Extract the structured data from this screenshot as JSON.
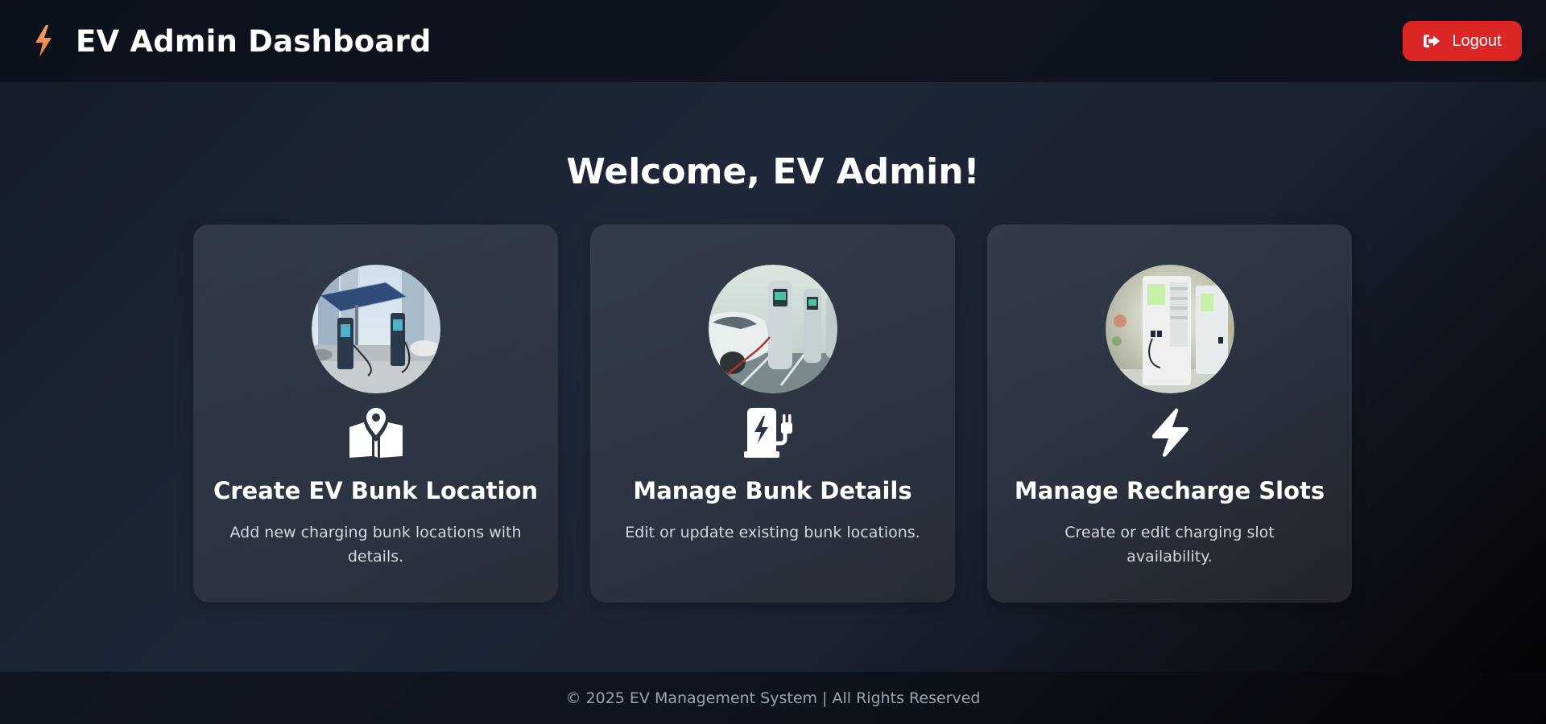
{
  "header": {
    "title": "EV Admin Dashboard",
    "brand_icon": "bolt-icon",
    "logout_label": "Logout",
    "logout_icon": "sign-out-icon"
  },
  "main": {
    "welcome": "Welcome, EV Admin!",
    "cards": [
      {
        "title": "Create EV Bunk Location",
        "description": "Add new charging bunk locations with details.",
        "icon": "map-location-icon",
        "image": "solar-charging-station-photo"
      },
      {
        "title": "Manage Bunk Details",
        "description": "Edit or update existing bunk locations.",
        "icon": "charging-station-icon",
        "image": "car-charging-photo"
      },
      {
        "title": "Manage Recharge Slots",
        "description": "Create or edit charging slot availability.",
        "icon": "bolt-icon",
        "image": "charger-kiosk-photo"
      }
    ]
  },
  "footer": {
    "text": "© 2025 EV Management System | All Rights Reserved"
  },
  "colors": {
    "accent_orange": "#f59e5b",
    "logout_red": "#dc2626"
  }
}
